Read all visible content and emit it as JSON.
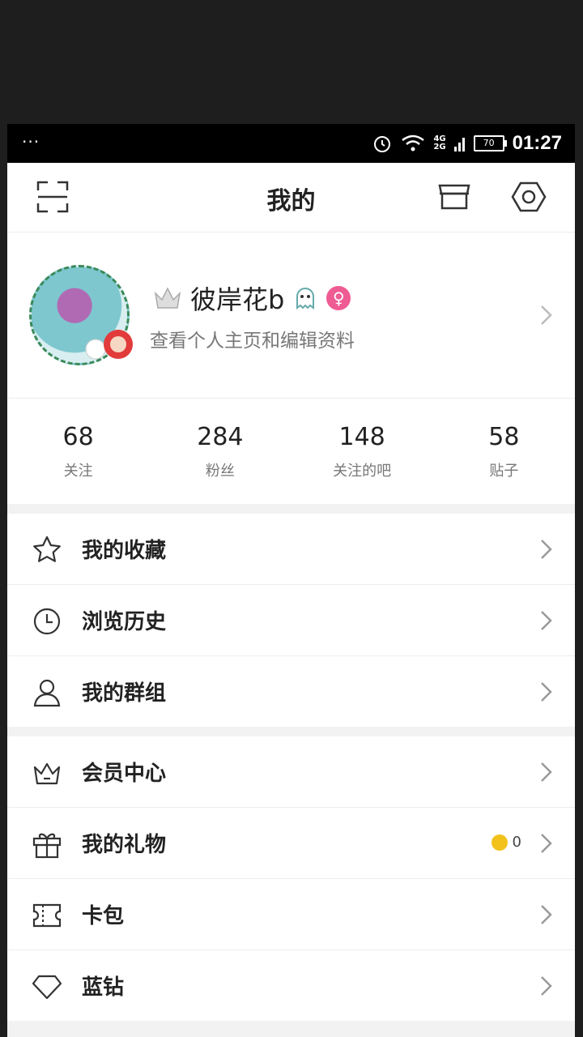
{
  "status_bar": {
    "dots": "···",
    "network_top": "4G",
    "network_bottom": "2G",
    "battery": "70",
    "time": "01:27"
  },
  "header": {
    "title": "我的"
  },
  "profile": {
    "name": "彼岸花b",
    "subtitle": "查看个人主页和编辑资料"
  },
  "stats": [
    {
      "value": "68",
      "label": "关注"
    },
    {
      "value": "284",
      "label": "粉丝"
    },
    {
      "value": "148",
      "label": "关注的吧"
    },
    {
      "value": "58",
      "label": "贴子"
    }
  ],
  "menu1": [
    {
      "label": "我的收藏",
      "icon": "star-icon"
    },
    {
      "label": "浏览历史",
      "icon": "clock-icon"
    },
    {
      "label": "我的群组",
      "icon": "person-icon"
    }
  ],
  "menu2": [
    {
      "label": "会员中心",
      "icon": "crown-icon"
    },
    {
      "label": "我的礼物",
      "icon": "gift-icon",
      "count": "0"
    },
    {
      "label": "卡包",
      "icon": "ticket-icon"
    },
    {
      "label": "蓝钻",
      "icon": "diamond-icon"
    }
  ]
}
